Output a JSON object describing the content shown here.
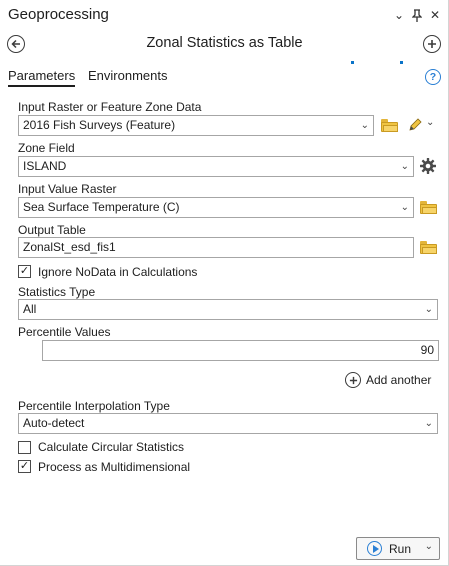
{
  "pane": {
    "title": "Geoprocessing",
    "menu_glyph": "⌄",
    "pin_glyph": "📌",
    "close_glyph": "✕"
  },
  "tool": {
    "title": "Zonal Statistics as Table",
    "back_glyph": "←",
    "add_glyph": "+"
  },
  "tabs": [
    {
      "label": "Parameters",
      "active": true
    },
    {
      "label": "Environments",
      "active": false
    }
  ],
  "help_glyph": "?",
  "params": {
    "input_zone": {
      "label": "Input Raster or Feature Zone Data",
      "value": "2016 Fish Surveys (Feature)"
    },
    "zone_field": {
      "label": "Zone Field",
      "value": "ISLAND"
    },
    "value_raster": {
      "label": "Input Value Raster",
      "value": "Sea Surface Temperature (C)"
    },
    "output_table": {
      "label": "Output Table",
      "value": "ZonalSt_esd_fis1"
    },
    "ignore_nodata": {
      "label": "Ignore NoData in Calculations",
      "checked": true
    },
    "statistics_type": {
      "label": "Statistics Type",
      "value": "All"
    },
    "percentile_values": {
      "label": "Percentile Values",
      "value": "90"
    },
    "add_another": {
      "label": "Add another"
    },
    "interpolation": {
      "label": "Percentile Interpolation Type",
      "value": "Auto-detect"
    },
    "circular_stats": {
      "label": "Calculate Circular Statistics",
      "checked": false
    },
    "multidimensional": {
      "label": "Process as Multidimensional",
      "checked": true
    }
  },
  "check_glyph": "✓",
  "dropdown_glyph": "⌄",
  "run": {
    "label": "Run",
    "arrow": "⌄"
  },
  "colors": {
    "accent": "#2a7fd4",
    "folder": "#f0c442"
  },
  "icons": [
    "back-arrow-icon",
    "add-circle-icon",
    "help-icon",
    "folder-icon",
    "pencil-icon",
    "gear-icon",
    "run-icon"
  ]
}
